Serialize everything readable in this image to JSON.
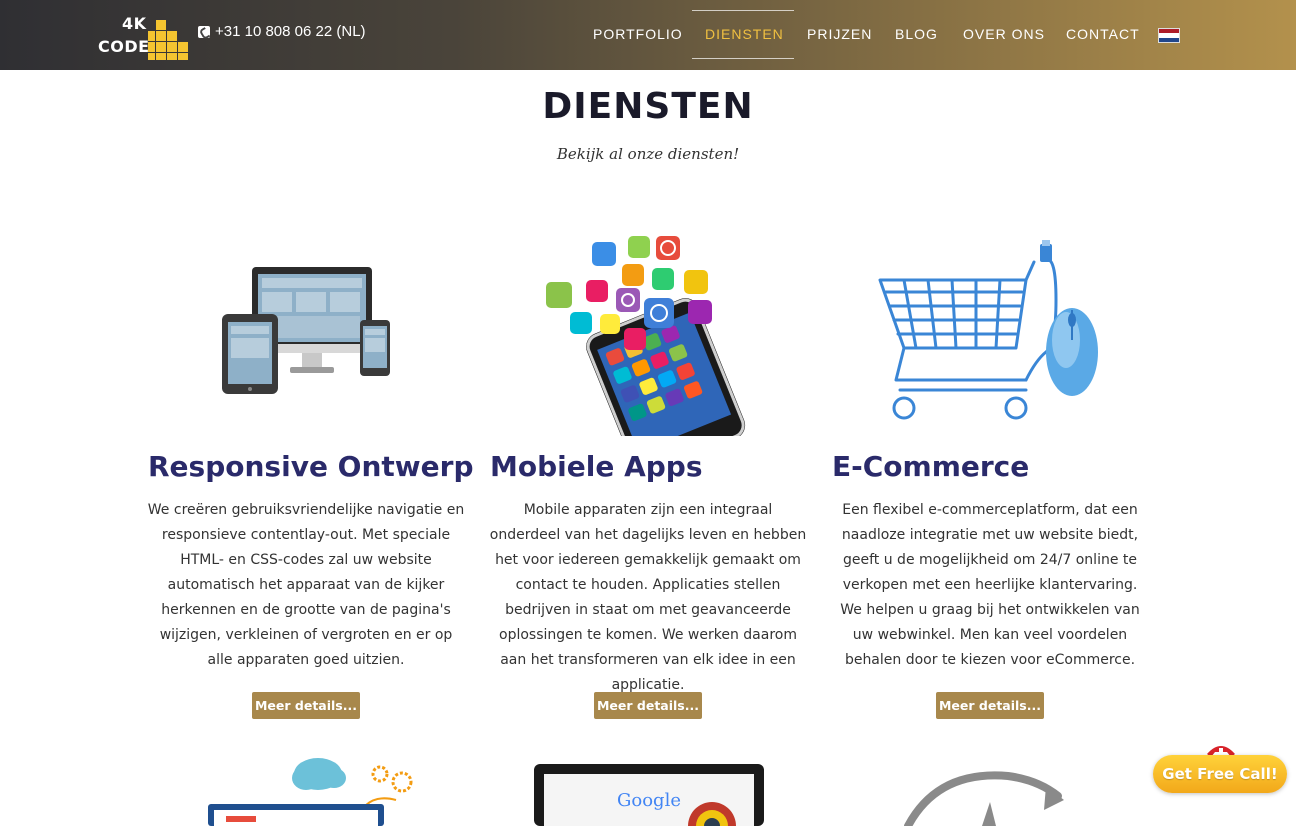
{
  "header": {
    "logo_line1": "4K",
    "logo_line2": "CODE",
    "phone": "+31 10 808 06 22 (NL)",
    "nav": [
      {
        "label": "PORTFOLIO"
      },
      {
        "label": "DIENSTEN"
      },
      {
        "label": "PRIJZEN"
      },
      {
        "label": "BLOG"
      },
      {
        "label": "OVER ONS"
      },
      {
        "label": "CONTACT"
      }
    ],
    "active_nav": "DIENSTEN",
    "language_flag": "netherlands-flag"
  },
  "page": {
    "title": "DIENSTEN",
    "subtitle": "Bekijk al onze diensten!"
  },
  "services": [
    {
      "title": "Responsive Ontwerp",
      "description": "We creëren gebruiksvriendelijke navigatie en responsieve contentlay-out. Met speciale HTML- en CSS-codes zal uw website automatisch het apparaat van de kijker herkennen en de grootte van de pagina's wijzigen, verkleinen of vergroten en er op alle apparaten goed uitzien.",
      "button": "Meer details...",
      "icon": "devices-illustration"
    },
    {
      "title": "Mobiele Apps",
      "description": "Mobile apparaten zijn een integraal onderdeel van het dagelijks leven en hebben het voor iedereen gemakkelijk gemaakt om contact te houden. Applicaties stellen bedrijven in staat om met geavanceerde oplossingen te komen. We werken daarom aan het transformeren van elk idee in een applicatie.",
      "button": "Meer details...",
      "icon": "smartphone-apps-illustration"
    },
    {
      "title": "E-Commerce",
      "description": "Een flexibel e-commerceplatform, dat een naadloze integratie met uw website biedt, geeft u de mogelijkheid om 24/7 online te verkopen met een heerlijke klantervaring. We helpen u graag bij het ontwikkelen van uw webwinkel. Men kan veel voordelen behalen door te kiezen voor eCommerce.",
      "button": "Meer details...",
      "icon": "shopping-cart-mouse-illustration"
    }
  ],
  "lower_row_text": {
    "google_logo": "Google"
  },
  "call_widget": {
    "label": "Get Free Call!"
  },
  "colors": {
    "accent_gold": "#a8884c",
    "active_nav": "#f0c040",
    "title_navy": "#2a2a6a",
    "call_yellow": "#f5b526"
  }
}
